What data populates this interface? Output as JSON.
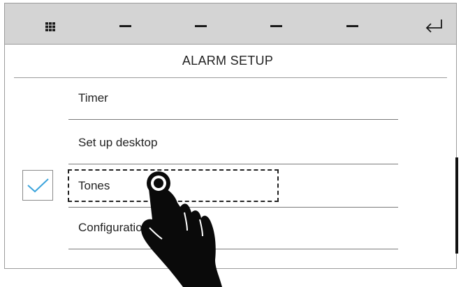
{
  "toolbar": {
    "left_icon": "grid-icon",
    "placeholder_icon": "dash-icon",
    "right_icon": "return-arrow-icon"
  },
  "screen": {
    "title": "ALARM SETUP"
  },
  "menu": {
    "items": [
      {
        "label": "Timer"
      },
      {
        "label": "Set up desktop"
      },
      {
        "label": "Tones"
      },
      {
        "label": "Configuration"
      }
    ],
    "selected_index": 2,
    "checked": true
  },
  "colors": {
    "toolbar_bg": "#d4d4d4",
    "check_accent": "#3ba4dc",
    "scroll_thumb": "#111111"
  }
}
